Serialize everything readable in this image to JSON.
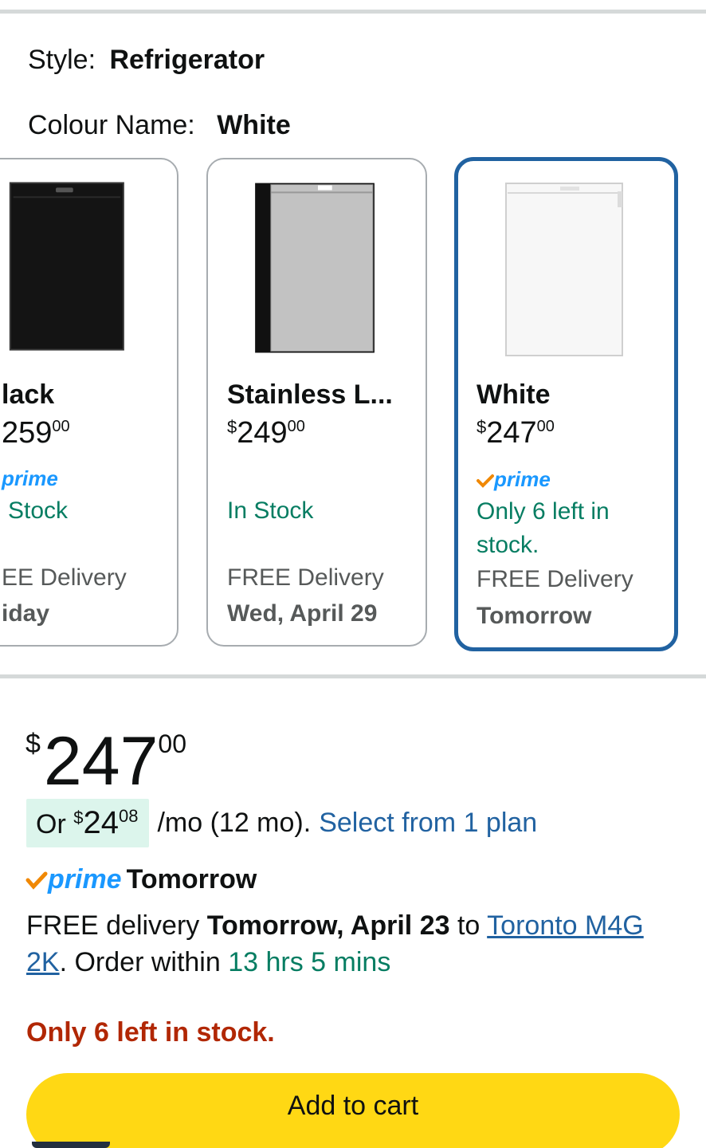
{
  "style": {
    "label": "Style:",
    "value": "Refrigerator"
  },
  "colour": {
    "label": "Colour Name:",
    "value": "White"
  },
  "swatches": [
    {
      "name": "lack",
      "currency": "$",
      "price_whole": "259",
      "price_frac": "00",
      "prime": "prime",
      "stock": "Stock",
      "delivery": "EE Delivery",
      "delivery_date": "iday",
      "fridge_color": "#1a1a1a"
    },
    {
      "name": "Stainless L...",
      "currency": "$",
      "price_whole": "249",
      "price_frac": "00",
      "stock": "In Stock",
      "delivery": "FREE Delivery",
      "delivery_date": "Wed, April 29",
      "fridge_color": "#b8b8b8"
    },
    {
      "name": "White",
      "currency": "$",
      "price_whole": "247",
      "price_frac": "00",
      "prime": "prime",
      "stock": "Only 6 left in stock.",
      "delivery": "FREE Delivery",
      "delivery_date": "Tomorrow",
      "fridge_color": "#f4f4f4",
      "selected": true
    }
  ],
  "price": {
    "currency": "$",
    "whole": "247",
    "frac": "00"
  },
  "monthly": {
    "prefix": "Or",
    "currency": "$",
    "whole": "24",
    "frac": "08",
    "suffix": "/mo (12 mo).",
    "link": "Select from 1 plan"
  },
  "prime_row": {
    "logo": "prime",
    "label": "Tomorrow"
  },
  "delivery": {
    "free": "FREE delivery",
    "date": "Tomorrow, April 23",
    "to": "to",
    "location": "Toronto M4G 2K",
    "order": ". Order within",
    "timer": "13 hrs 5 mins"
  },
  "low_stock": "Only 6 left in stock.",
  "cart_button": "Add to cart",
  "colors": {
    "accent_link": "#2162a1",
    "prime_blue": "#1a98ff",
    "prime_check": "#f08804",
    "in_stock_green": "#067d62",
    "low_stock_red": "#b12704",
    "cart_yellow": "#ffd814",
    "selected_border": "#2162a1"
  }
}
